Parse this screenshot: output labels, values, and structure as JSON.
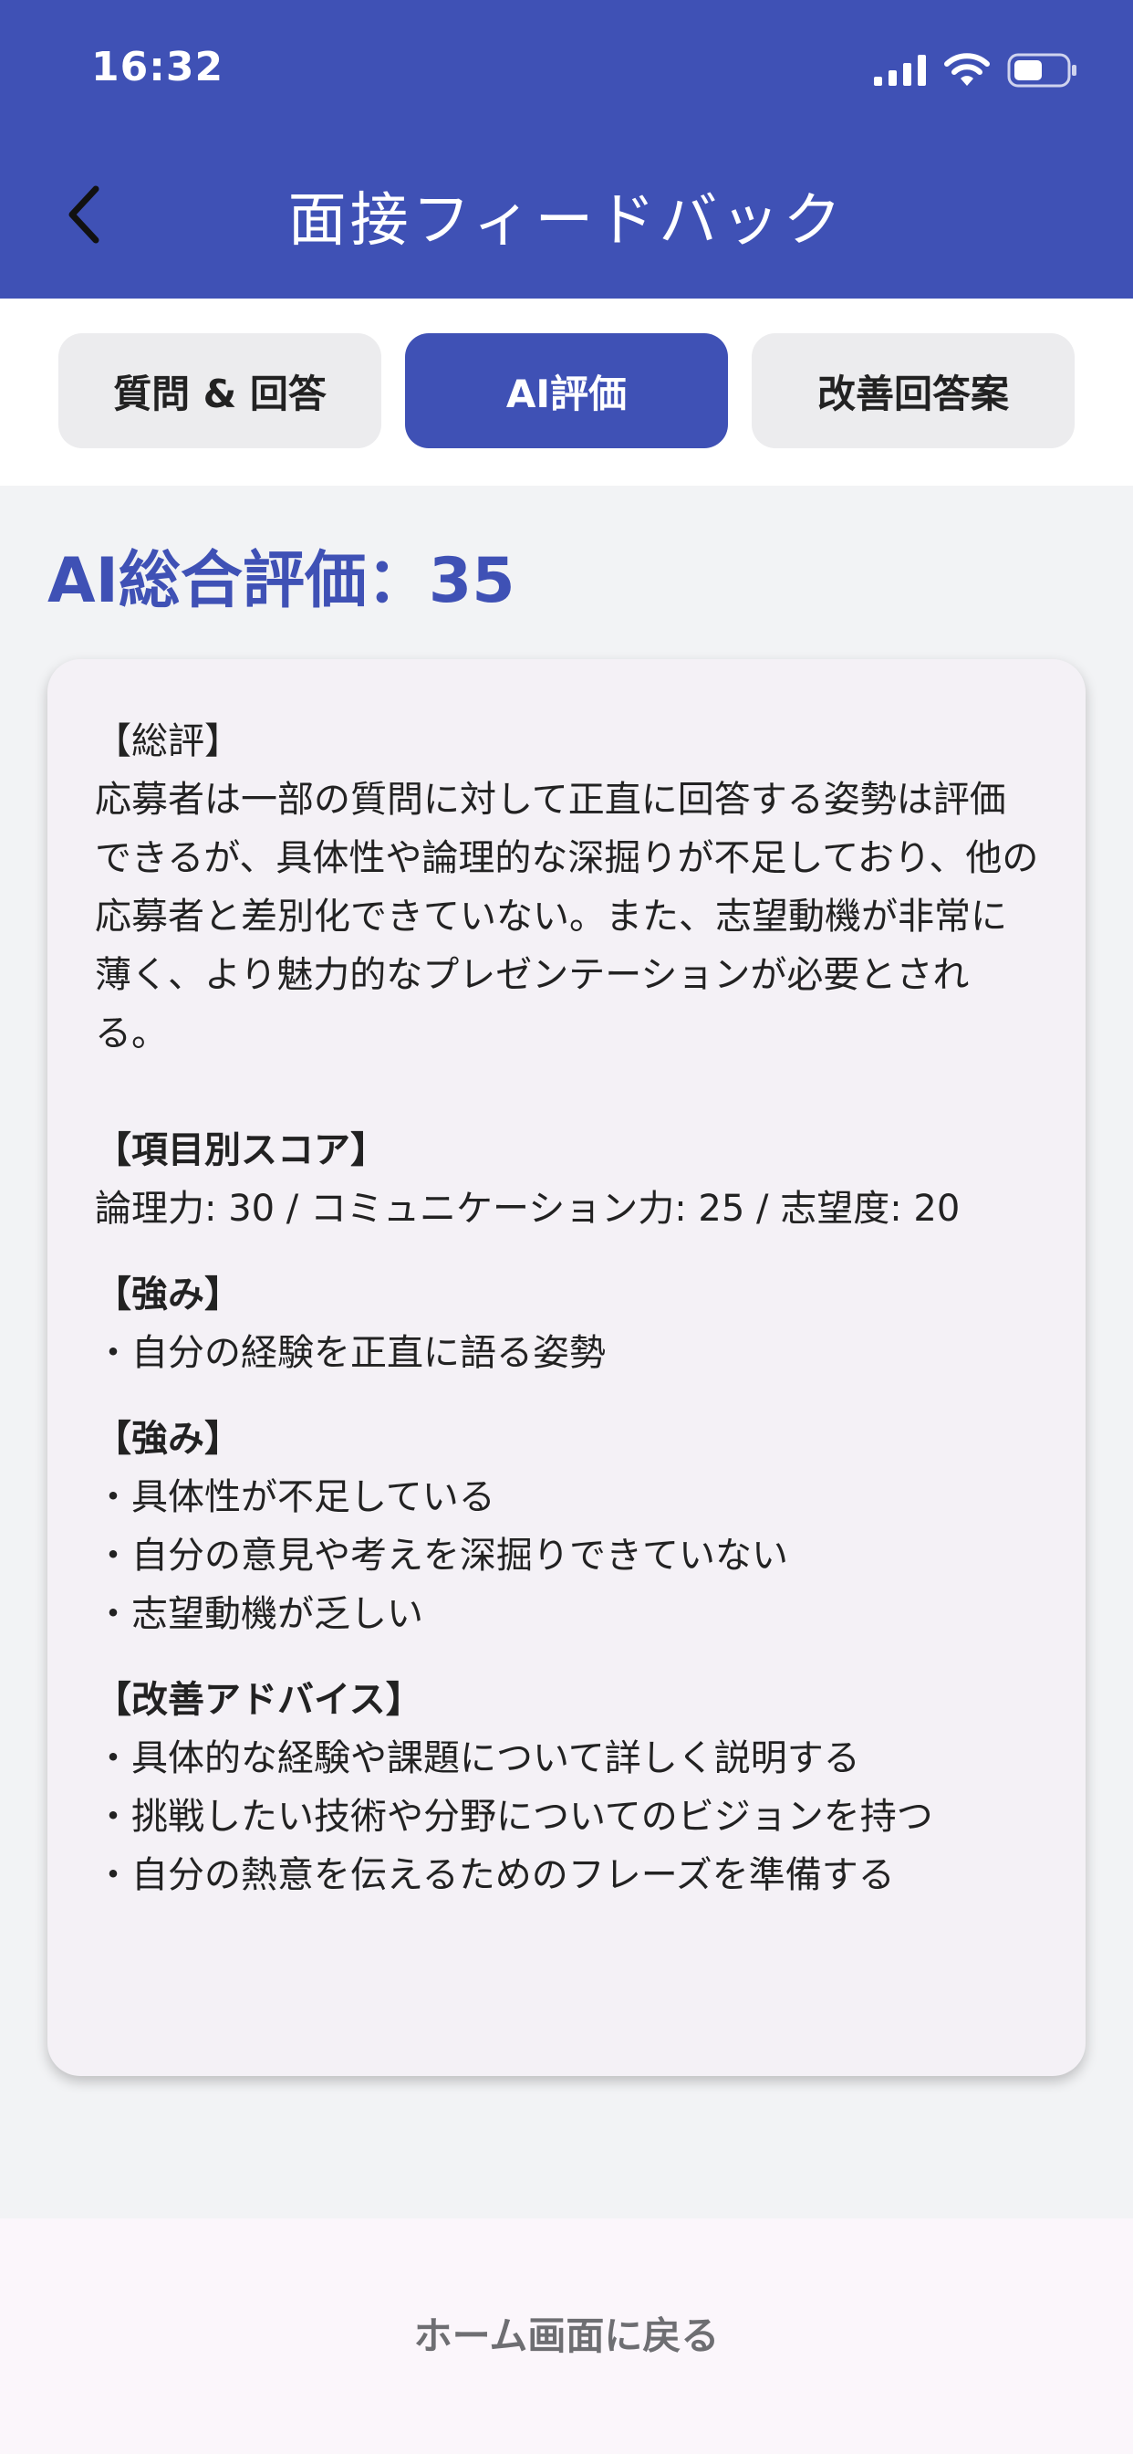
{
  "status_bar": {
    "time": "16:32"
  },
  "header": {
    "title": "面接フィードバック"
  },
  "tabs": [
    {
      "label": "質問 & 回答"
    },
    {
      "label": "AI評価"
    },
    {
      "label": "改善回答案"
    }
  ],
  "active_tab_index": 1,
  "score": {
    "heading": "AI総合評価：35"
  },
  "evaluation": {
    "summary_title": "【総評】",
    "summary_text": "応募者は一部の質問に対して正直に回答する姿勢は評価できるが、具体性や論理的な深掘りが不足しており、他の応募者と差別化できていない。また、志望動機が非常に薄く、より魅力的なプレゼンテーションが必要とされる。",
    "scores_title": "【項目別スコア】",
    "scores_text": "論理力: 30 / コミュニケーション力: 25 / 志望度: 20",
    "strengths_title": "【強み】",
    "strengths": [
      "・自分の経験を正直に語る姿勢"
    ],
    "weaknesses_title": "【強み】",
    "weaknesses": [
      "・具体性が不足している",
      "・自分の意見や考えを深掘りできていない",
      "・志望動機が乏しい"
    ],
    "advice_title": "【改善アドバイス】",
    "advice": [
      "・具体的な経験や課題について詳しく説明する",
      "・挑戦したい技術や分野についてのビジョンを持つ",
      "・自分の熱意を伝えるためのフレーズを準備する"
    ]
  },
  "footer": {
    "home_label": "ホーム画面に戻る"
  },
  "colors": {
    "primary": "#3F51B5",
    "background": "#F2F3F5",
    "card": "#F4F1F6"
  }
}
